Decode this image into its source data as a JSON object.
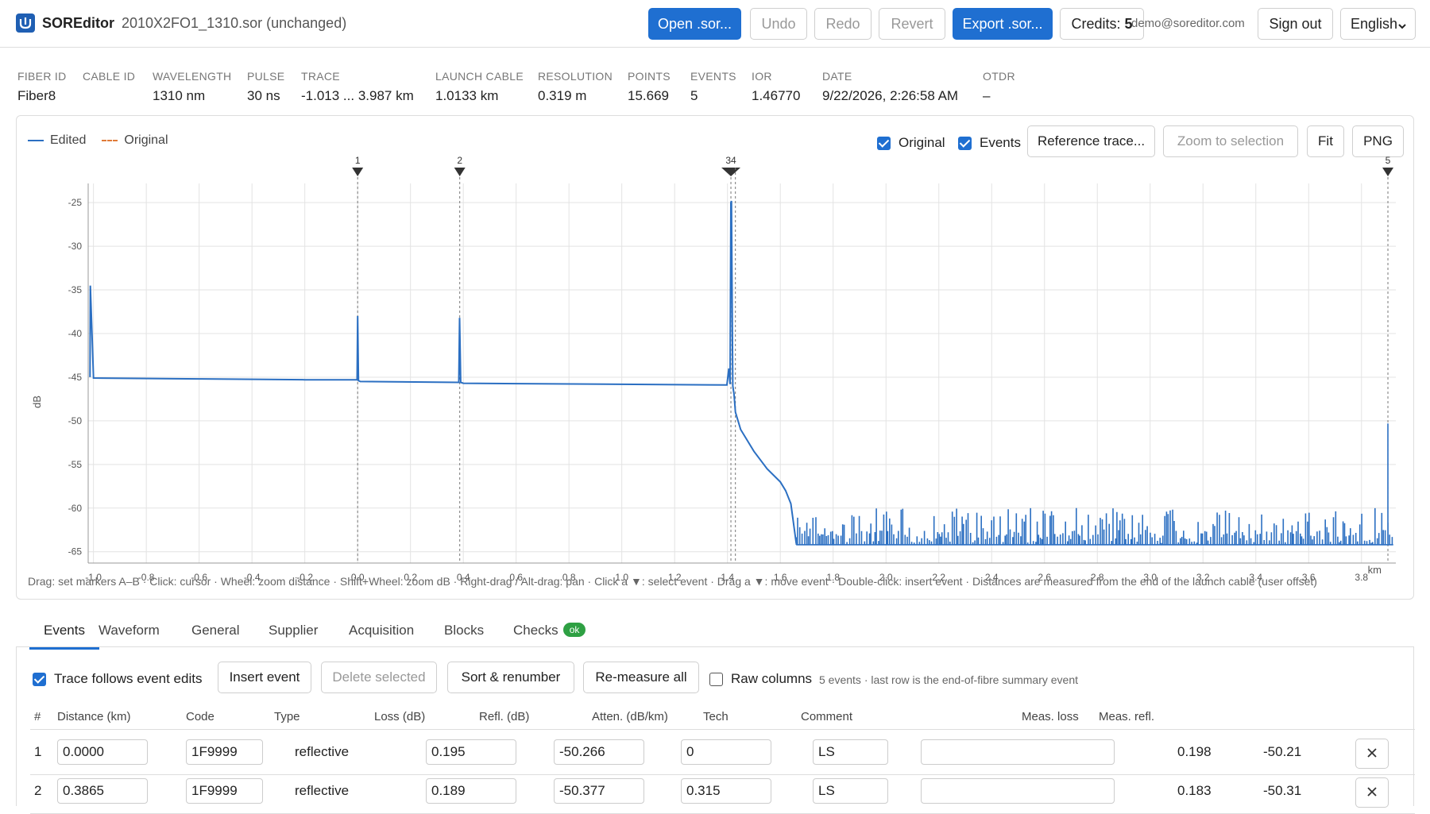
{
  "header": {
    "app_name": "SOREditor",
    "file_name": "2010X2FO1_1310.sor (unchanged)",
    "open_label": "Open .sor...",
    "undo_label": "Undo",
    "redo_label": "Redo",
    "revert_label": "Revert",
    "export_label": "Export .sor...",
    "credits_label": "Credits:",
    "credits_value": "5",
    "email": "demo@soreditor.com",
    "signout_label": "Sign out",
    "language": "English"
  },
  "meta": [
    {
      "label": "FIBER ID",
      "value": "Fiber8"
    },
    {
      "label": "CABLE ID",
      "value": ""
    },
    {
      "label": "WAVELENGTH",
      "value": "1310 nm"
    },
    {
      "label": "PULSE",
      "value": "30 ns"
    },
    {
      "label": "TRACE",
      "value": "-1.013 ... 3.987 km"
    },
    {
      "label": "LAUNCH CABLE",
      "value": "1.0133 km"
    },
    {
      "label": "RESOLUTION",
      "value": "0.319 m"
    },
    {
      "label": "POINTS",
      "value": "15.669"
    },
    {
      "label": "EVENTS",
      "value": "5"
    },
    {
      "label": "IOR",
      "value": "1.46770"
    },
    {
      "label": "DATE",
      "value": "9/22/2026, 2:26:58 AM"
    },
    {
      "label": "OTDR",
      "value": "–"
    }
  ],
  "chart_toolbar": {
    "legend_edited": "Edited",
    "legend_original": "Original",
    "original_label": "Original",
    "events_label": "Events",
    "reference_label": "Reference trace...",
    "zoom_label": "Zoom to selection",
    "fit_label": "Fit",
    "png_label": "PNG"
  },
  "chart_hint": "Drag: set markers A–B · Click: cursor · Wheel: zoom distance · Shift+Wheel: zoom dB · Right-drag / Alt-drag: pan · Click a ▼: select event · Drag a ▼: move event · Double-click: insert event · Distances are measured from the end of the launch cable (user offset)",
  "chart_data": {
    "type": "line",
    "xlabel": "km",
    "ylabel": "dB",
    "xlim": [
      -1.02,
      3.93
    ],
    "ylim": [
      -66.3,
      -22.8
    ],
    "xticks": [
      -1.0,
      -0.8,
      -0.6,
      -0.4,
      -0.2,
      0.0,
      0.2,
      0.4,
      0.6,
      0.8,
      1.0,
      1.2,
      1.4,
      1.6,
      1.8,
      2.0,
      2.2,
      2.4,
      2.6,
      2.8,
      3.0,
      3.2,
      3.4,
      3.6,
      3.8
    ],
    "xtick_labels": [
      "-1.0",
      "-0.8",
      "-0.6",
      "-0.4",
      "-0.2",
      "0.0",
      "0.2",
      "0.4",
      "0.6",
      "0.8",
      "1.0",
      "1.2",
      "1.4",
      "1.6",
      "1.8",
      "2.0",
      "2.2",
      "2.4",
      "2.6",
      "2.8",
      "3.0",
      "3.2",
      "3.4",
      "3.6",
      "3.8"
    ],
    "yticks": [
      -25,
      -30,
      -35,
      -40,
      -45,
      -50,
      -55,
      -60,
      -65
    ],
    "ytick_labels": [
      "-25",
      "-30",
      "-35",
      "-40",
      "-45",
      "-50",
      "-55",
      "-60",
      "-65"
    ],
    "grid": true,
    "series": [
      {
        "name": "Edited",
        "color": "#2b6fc2",
        "x": [
          -1.013,
          -1.012,
          -1.0,
          -0.6,
          -0.2,
          -0.002,
          0.0,
          0.003,
          0.01,
          0.383,
          0.386,
          0.39,
          0.4,
          1.398,
          1.405,
          1.41,
          1.413,
          1.415,
          1.418,
          1.42,
          1.425,
          1.43,
          1.45,
          1.5,
          1.55,
          1.6,
          1.62,
          1.64,
          1.66
        ],
        "y": [
          -45.0,
          -34.5,
          -45.1,
          -45.2,
          -45.3,
          -45.3,
          -38.0,
          -45.4,
          -45.5,
          -45.6,
          -38.2,
          -45.6,
          -45.7,
          -45.9,
          -44.0,
          -45.8,
          -25.0,
          -24.8,
          -38.0,
          -46.0,
          -47.0,
          -49.0,
          -51.0,
          -53.5,
          -55.5,
          -57.0,
          -58.0,
          -59.5,
          -64.0
        ]
      }
    ],
    "events": [
      {
        "label": "1",
        "x": 0.0
      },
      {
        "label": "2",
        "x": 0.3865
      },
      {
        "label": "34",
        "x": 1.413
      },
      {
        "label": "5",
        "x": 3.9
      }
    ]
  },
  "tabs": [
    {
      "label": "Events",
      "active": true
    },
    {
      "label": "Waveform"
    },
    {
      "label": "General"
    },
    {
      "label": "Supplier"
    },
    {
      "label": "Acquisition"
    },
    {
      "label": "Blocks"
    },
    {
      "label": "Checks",
      "badge": "ok"
    }
  ],
  "events_toolbar": {
    "follow_label": "Trace follows event edits",
    "insert_label": "Insert event",
    "delete_label": "Delete selected",
    "sort_label": "Sort & renumber",
    "remeasure_label": "Re-measure all",
    "raw_label": "Raw columns",
    "note": "5 events · last row is the end-of-fibre summary event"
  },
  "events_table": {
    "columns": [
      "#",
      "Distance (km)",
      "Code",
      "Type",
      "Loss (dB)",
      "Refl. (dB)",
      "Atten. (dB/km)",
      "Tech",
      "Comment",
      "Meas. loss",
      "Meas. refl."
    ],
    "rows": [
      {
        "num": "1",
        "distance": "0.0000",
        "code": "1F9999",
        "type": "reflective",
        "loss": "0.195",
        "refl": "-50.266",
        "atten": "0",
        "tech": "LS",
        "comment": "",
        "meas_loss": "0.198",
        "meas_refl": "-50.21"
      },
      {
        "num": "2",
        "distance": "0.3865",
        "code": "1F9999",
        "type": "reflective",
        "loss": "0.189",
        "refl": "-50.377",
        "atten": "0.315",
        "tech": "LS",
        "comment": "",
        "meas_loss": "0.183",
        "meas_refl": "-50.31"
      }
    ]
  }
}
